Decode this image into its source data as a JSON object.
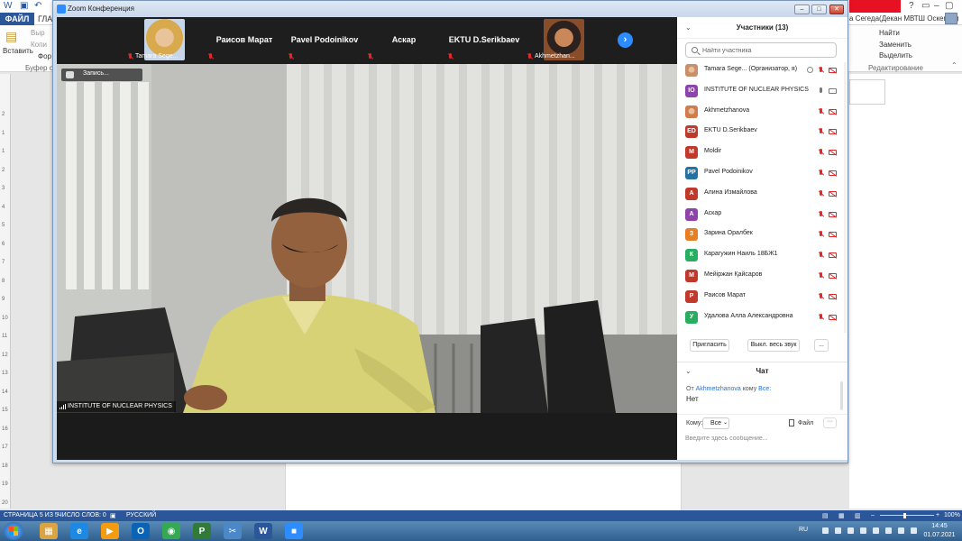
{
  "word": {
    "file_tab": "ФАЙЛ",
    "home_tab": "ГЛАВ",
    "user": "а Сегеда(Декан МВТШ Оскемен)",
    "ribbon": {
      "paste": "Вставить",
      "cut": "Выр",
      "copy": "Копи",
      "format": "Фор",
      "clipboard": "Буфер об",
      "find": "Найти",
      "replace": "Заменить",
      "select": "Выделить",
      "editing": "Редактирование"
    },
    "status": {
      "page": "СТРАНИЦА 5 ИЗ 5",
      "words": "ЧИСЛО СЛОВ: 0",
      "lang": "РУССКИЙ",
      "zoom": "100%"
    },
    "ruler_nums": [
      "2",
      "1",
      "1",
      "2",
      "3",
      "4",
      "5",
      "6",
      "7",
      "8",
      "9",
      "10",
      "11",
      "12",
      "13",
      "14",
      "15",
      "16",
      "17",
      "18",
      "19",
      "20"
    ]
  },
  "taskbar": {
    "lang": "RU",
    "time": "14:45",
    "date": "01.07.2021",
    "apps": [
      {
        "name": "explorer-icon",
        "glyph": "▦",
        "color": "#d9a441"
      },
      {
        "name": "ie-icon",
        "glyph": "e",
        "color": "#1e88e5"
      },
      {
        "name": "media-player-icon",
        "glyph": "▶",
        "color": "#f39c12"
      },
      {
        "name": "outlook-icon",
        "glyph": "O",
        "color": "#0b63b5"
      },
      {
        "name": "chrome-icon",
        "glyph": "◉",
        "color": "#34a853"
      },
      {
        "name": "project-icon",
        "glyph": "P",
        "color": "#317a39"
      },
      {
        "name": "snipping-icon",
        "glyph": "✂",
        "color": "#4b88c7"
      },
      {
        "name": "word-icon",
        "glyph": "W",
        "color": "#2b579a"
      },
      {
        "name": "zoom-icon",
        "glyph": "■",
        "color": "#2d8cff"
      }
    ]
  },
  "zoom": {
    "title": "Zoom Конференция",
    "recording": "Запись...",
    "speaker": "INSTITUTE OF NUCLEAR PHYSICS",
    "thumbnails": [
      {
        "label": "Tamara Sege...",
        "photo": true
      },
      {
        "label": "Раисов Марат",
        "photo": false
      },
      {
        "label": "Pavel Podoinikov",
        "photo": false
      },
      {
        "label": "Аскар",
        "photo": false
      },
      {
        "label": "EKTU D.Serikbaev",
        "photo": false
      },
      {
        "label": "Akhmetzhan...",
        "photo": true
      }
    ],
    "participants": {
      "title": "Участники (13)",
      "search_placeholder": "Найти участника",
      "list": [
        {
          "initials": "",
          "name": "Tamara Sege...  (Организатор, я)",
          "color": "#c98f6a",
          "photo": true,
          "mic": "off",
          "cam": "off"
        },
        {
          "initials": "IO",
          "name": "INSTITUTE OF NUCLEAR PHYSICS",
          "color": "#8e44ad",
          "photo": false,
          "mic": "on",
          "cam": "on"
        },
        {
          "initials": "",
          "name": "Akhmetzhanova",
          "color": "#d07c4e",
          "photo": true,
          "mic": "off",
          "cam": "off"
        },
        {
          "initials": "ED",
          "name": "EKTU D.Serikbaev",
          "color": "#c0392b",
          "photo": false,
          "mic": "off",
          "cam": "off"
        },
        {
          "initials": "M",
          "name": "Moldir",
          "color": "#c0392b",
          "photo": false,
          "mic": "off",
          "cam": "off"
        },
        {
          "initials": "PP",
          "name": "Pavel Podoinikov",
          "color": "#2471a3",
          "photo": false,
          "mic": "off",
          "cam": "off"
        },
        {
          "initials": "А",
          "name": "Алина Измайлова",
          "color": "#c0392b",
          "photo": false,
          "mic": "off",
          "cam": "off"
        },
        {
          "initials": "А",
          "name": "Аскар",
          "color": "#8e44ad",
          "photo": false,
          "mic": "off",
          "cam": "off"
        },
        {
          "initials": "З",
          "name": "Зарина Оралбек",
          "color": "#e67e22",
          "photo": false,
          "mic": "off",
          "cam": "off"
        },
        {
          "initials": "К",
          "name": "Карагужин Наиль 18БЖ1",
          "color": "#27ae60",
          "photo": false,
          "mic": "off",
          "cam": "off"
        },
        {
          "initials": "М",
          "name": "Мейіржан Қайсаров",
          "color": "#c0392b",
          "photo": false,
          "mic": "off",
          "cam": "off"
        },
        {
          "initials": "Р",
          "name": "Раисов Марат",
          "color": "#c0392b",
          "photo": false,
          "mic": "off",
          "cam": "off"
        },
        {
          "initials": "У",
          "name": "Удалова Алла Александровна",
          "color": "#27ae60",
          "photo": false,
          "mic": "off",
          "cam": "off"
        }
      ],
      "invite": "Пригласить",
      "mute_all": "Выкл. весь звук",
      "more": "..."
    },
    "chat": {
      "title": "Чат",
      "from_prefix": "От",
      "from_name": "Akhmetzhanova",
      "to_word": "кому",
      "to_name": "Все:",
      "message": "Нет",
      "to_label": "Кому:",
      "to_value": "Все",
      "file": "Файл",
      "more": "···",
      "input_placeholder": "Введите здесь сообщение..."
    }
  }
}
